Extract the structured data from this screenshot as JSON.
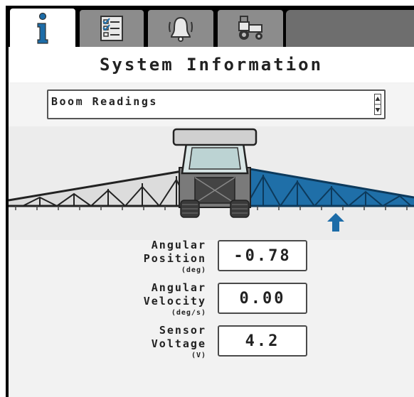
{
  "tabs": [
    {
      "icon": "info-icon",
      "active": true
    },
    {
      "icon": "checklist-icon",
      "active": false
    },
    {
      "icon": "alarm-bell-icon",
      "active": false
    },
    {
      "icon": "tractor-icon",
      "active": false
    }
  ],
  "page": {
    "title": "System Information"
  },
  "selector": {
    "value": "Boom Readings"
  },
  "readings": [
    {
      "label_line1": "Angular",
      "label_line2": "Position",
      "unit": "(deg)",
      "value": "-0.78"
    },
    {
      "label_line1": "Angular",
      "label_line2": "Velocity",
      "unit": "(deg/s)",
      "value": "0.00"
    },
    {
      "label_line1": "Sensor",
      "label_line2": "Voltage",
      "unit": "(V)",
      "value": "4.2"
    }
  ],
  "colors": {
    "tab": "#8c8c8c",
    "highlight_boom": "#1f6fa8",
    "arrow": "#1c6ca8"
  }
}
